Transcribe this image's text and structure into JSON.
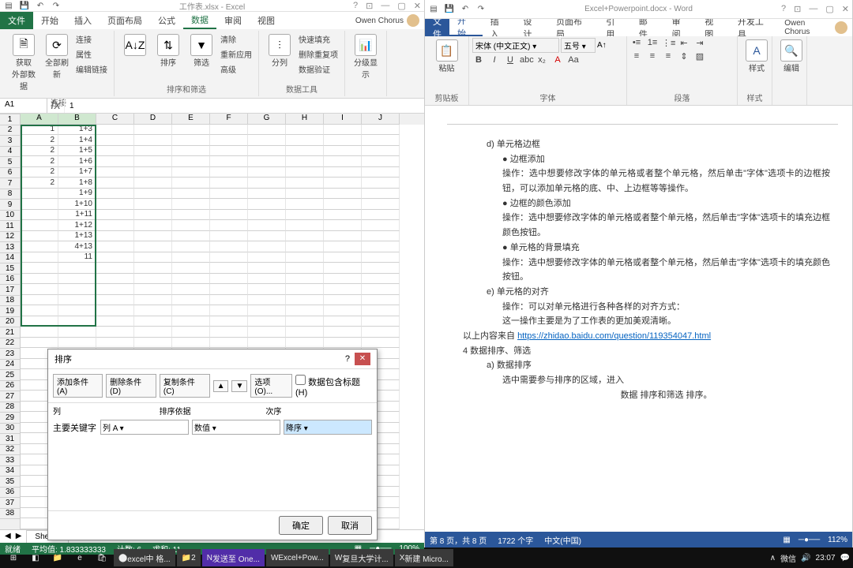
{
  "excel": {
    "title": "工作表.xlsx - Excel",
    "tabs": {
      "file": "文件",
      "home": "开始",
      "insert": "插入",
      "layout": "页面布局",
      "formulas": "公式",
      "data": "数据",
      "review": "审阅",
      "view": "视图"
    },
    "user": "Owen Chorus",
    "ribbon": {
      "g1": {
        "b1": "获取\n外部数据",
        "b2": "全部刷新",
        "s1": "连接",
        "s2": "属性",
        "s3": "编辑链接",
        "lbl": "连接"
      },
      "g2": {
        "b1": "排序",
        "b2": "筛选",
        "s1": "清除",
        "s2": "重新应用",
        "s3": "高级",
        "lbl": "排序和筛选"
      },
      "g3": {
        "b1": "分列",
        "s1": "快速填充",
        "s2": "删除重复项",
        "s3": "数据验证",
        "lbl": "数据工具"
      },
      "g4": {
        "b1": "分级显示",
        "lbl": ""
      }
    },
    "namebox": "A1",
    "formula": "1",
    "cols": [
      "A",
      "B",
      "C",
      "D",
      "E",
      "F",
      "G",
      "H",
      "I",
      "J"
    ],
    "data": [
      [
        "1",
        "1+3"
      ],
      [
        "2",
        "1+4"
      ],
      [
        "2",
        "1+5"
      ],
      [
        "2",
        "1+6"
      ],
      [
        "2",
        "1+7"
      ],
      [
        "2",
        "1+8"
      ],
      [
        "",
        "1+9"
      ],
      [
        "",
        "1+10"
      ],
      [
        "",
        "1+11"
      ],
      [
        "",
        "1+12"
      ],
      [
        "",
        "1+13"
      ],
      [
        "",
        "4+13"
      ],
      [
        "",
        "11"
      ]
    ],
    "sheet": "Sheet1",
    "status": {
      "ready": "就绪",
      "avg": "平均值: 1.833333333",
      "count": "计数: 6",
      "sum": "求和: 11",
      "zoom": "100%"
    }
  },
  "dialog": {
    "title": "排序",
    "help": "?",
    "add": "添加条件(A)",
    "del": "删除条件(D)",
    "copy": "复制条件(C)",
    "options": "选项(O)...",
    "header": "数据包含标题(H)",
    "colh": "列",
    "sorth": "排序依据",
    "orderh": "次序",
    "keylabel": "主要关键字",
    "keycol": "列 A",
    "basis": "数值",
    "order": "降序",
    "ok": "确定",
    "cancel": "取消"
  },
  "word": {
    "title": "Excel+Powerpoint.docx - Word",
    "tabs": {
      "file": "文件",
      "home": "开始",
      "insert": "插入",
      "design": "设计",
      "layout": "页面布局",
      "refs": "引用",
      "mail": "邮件",
      "review": "审阅",
      "view": "视图",
      "dev": "开发工具"
    },
    "user": "Owen Chorus",
    "ribbon": {
      "paste": "粘贴",
      "clip": "剪贴板",
      "fontname": "宋体 (中文正文)",
      "fontsize": "五号",
      "font": "字体",
      "para": "段落",
      "style": "样式",
      "edit": "编辑"
    },
    "doc": {
      "d_item": "d)    单元格边框",
      "p1": "●    边框添加",
      "p1t": "操作：选中想要修改字体的单元格或者整个单元格，然后单击\"字体\"选项卡的边框按钮，可以添加单元格的底、中、上边框等等操作。",
      "p2": "●    边框的颜色添加",
      "p2t": "操作：选中想要修改字体的单元格或者整个单元格，然后单击\"字体\"选项卡的填充边框颜色按钮。",
      "p3": "●    单元格的背景填充",
      "p3t": "操作：选中想要修改字体的单元格或者整个单元格，然后单击\"字体\"选项卡的填充颜色按钮。",
      "e_item": "e)    单元格的对齐",
      "e_t1": "操作：可以对单元格进行各种各样的对齐方式：",
      "e_t2": "这一操作主要是为了工作表的更加美观清晰。",
      "src": "以上内容来自 ",
      "link": "https://zhidao.baidu.com/question/119354047.html",
      "sec4": "4    数据排序、筛选",
      "a_item": "a)    数据排序",
      "a_t": "选中需要参与排序的区域，进入",
      "a_extra": "数据    排序和筛选    排序。"
    },
    "status": {
      "page": "第 8 页，共 8 页",
      "words": "1722 个字",
      "lang": "中文(中国)",
      "zoom": "112%"
    }
  },
  "taskbar": {
    "items": [
      "excel中 格...",
      "2",
      "发送至 One...",
      "Excel+Pow...",
      "复旦大学计...",
      "新建 Micro..."
    ],
    "wechat": "微信",
    "clock": "23:07"
  }
}
